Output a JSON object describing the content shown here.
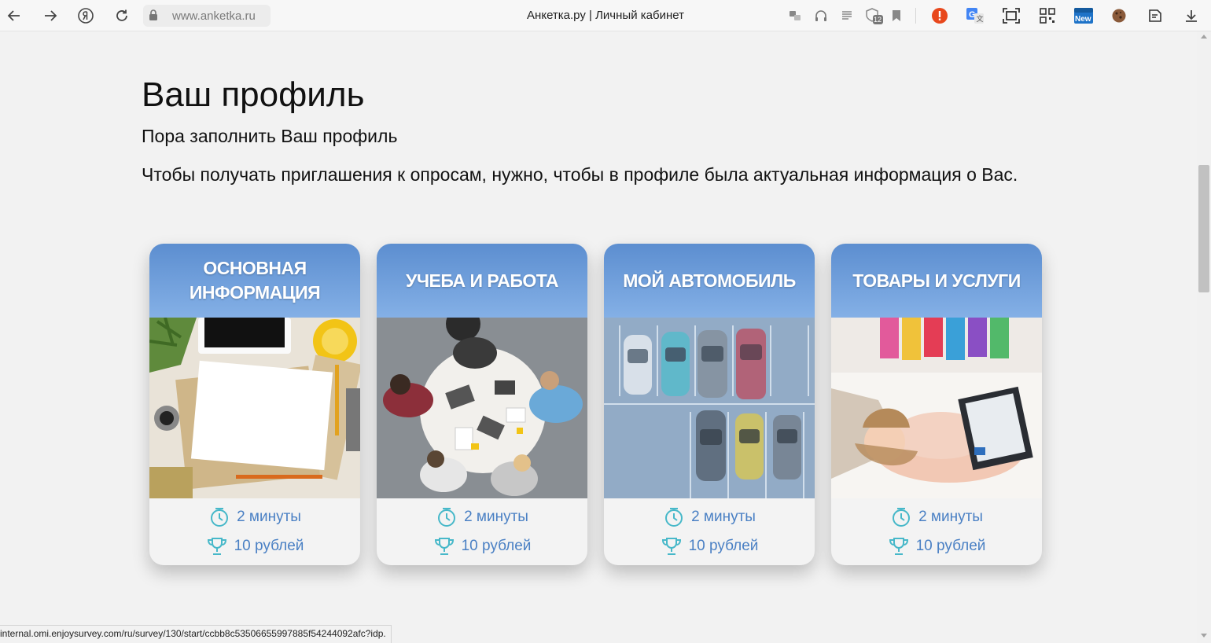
{
  "browser": {
    "url": "www.anketka.ru",
    "tab_title": "Анкетка.ру | Личный кабинет",
    "status_url": "internal.omi.enjoysurvey.com/ru/survey/130/start/ccbb8c53506655997885f54244092afc?idp.",
    "ext_badge": "12",
    "new_badge": "New"
  },
  "page": {
    "title": "Ваш профиль",
    "subtitle": "Пора заполнить Ваш профиль",
    "lead": "Чтобы получать приглашения к опросам, нужно, чтобы в профиле была актуальная информация о Вас."
  },
  "cards": [
    {
      "title": "Основная информация",
      "duration": "2 минуты",
      "reward": "10 рублей",
      "image": "desk-workspace"
    },
    {
      "title": "Учеба и работа",
      "duration": "2 минуты",
      "reward": "10 рублей",
      "image": "team-meeting"
    },
    {
      "title": "Мой автомобиль",
      "duration": "2 минуты",
      "reward": "10 рублей",
      "image": "parking-lot"
    },
    {
      "title": "Товары и услуги",
      "duration": "2 минуты",
      "reward": "10 рублей",
      "image": "online-shopping"
    }
  ],
  "colors": {
    "card_header_top": "#5c8ed0",
    "card_header_bottom": "#84b0e6",
    "meta_text": "#4a80c4",
    "icon_teal": "#47b8c9",
    "alert_red": "#e8481c"
  }
}
